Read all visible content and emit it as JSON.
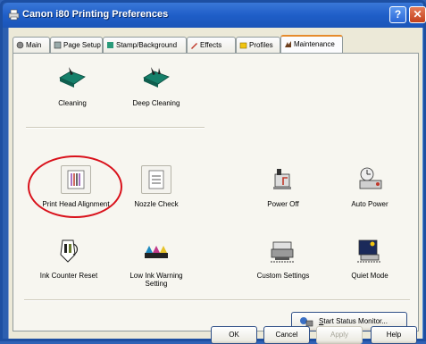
{
  "window": {
    "title": "Canon i80 Printing Preferences",
    "help_label": "?",
    "close_label": "✕"
  },
  "tabs": [
    {
      "label": "Main",
      "icon": "main-icon"
    },
    {
      "label": "Page Setup",
      "icon": "page-setup-icon"
    },
    {
      "label": "Stamp/Background",
      "icon": "stamp-icon"
    },
    {
      "label": "Effects",
      "icon": "effects-icon"
    },
    {
      "label": "Profiles",
      "icon": "profiles-icon"
    },
    {
      "label": "Maintenance",
      "icon": "maintenance-icon",
      "active": true
    }
  ],
  "maintenance": {
    "cleaning": "Cleaning",
    "deep_cleaning": "Deep Cleaning",
    "print_head_alignment": "Print Head Alignment",
    "nozzle_check": "Nozzle Check",
    "power_off": "Power Off",
    "auto_power": "Auto Power",
    "ink_counter_reset": "Ink Counter Reset",
    "low_ink_warning_setting": "Low Ink Warning Setting",
    "custom_settings": "Custom Settings",
    "quiet_mode": "Quiet Mode",
    "status_monitor_first": "S",
    "status_monitor_rest": "tart Status Monitor..."
  },
  "buttons": {
    "ok": "OK",
    "cancel": "Cancel",
    "apply": "Apply",
    "help": "Help"
  },
  "colors": {
    "titlebar": "#1f5ec8",
    "highlight_ring": "#d9111b",
    "active_tab_accent": "#e68b2c"
  }
}
